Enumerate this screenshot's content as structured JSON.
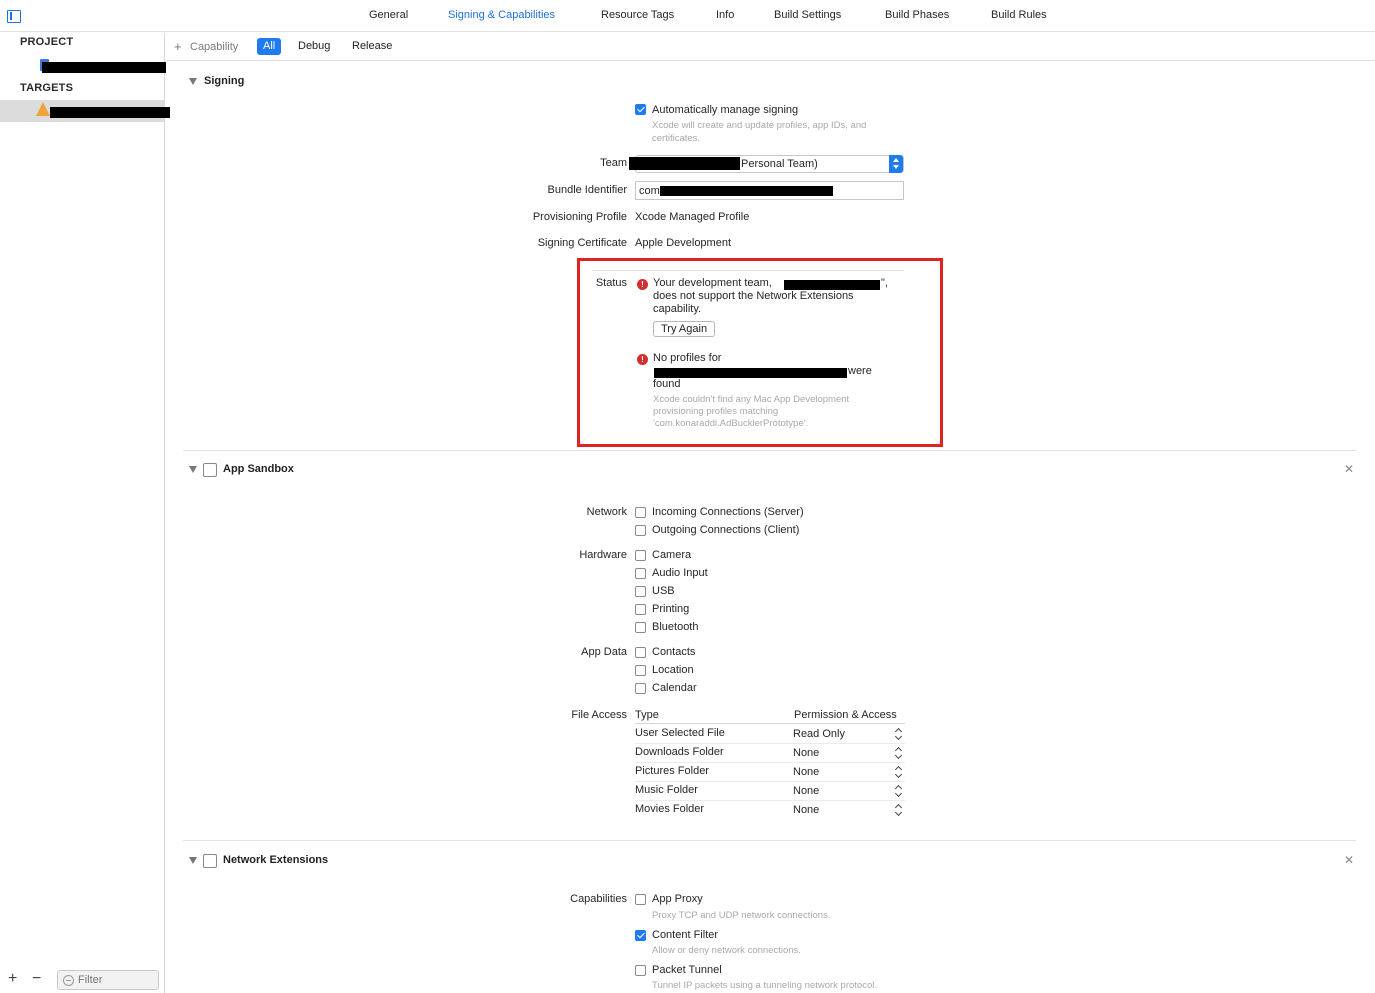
{
  "tabs": [
    "General",
    "Signing & Capabilities",
    "Resource Tags",
    "Info",
    "Build Settings",
    "Build Phases",
    "Build Rules"
  ],
  "active_tab": "Signing & Capabilities",
  "sidebar": {
    "project_header": "PROJECT",
    "targets_header": "TARGETS",
    "filter_placeholder": "Filter"
  },
  "toolbar": {
    "capability_label": "Capability",
    "segments": [
      "All",
      "Debug",
      "Release"
    ],
    "active_segment": "All"
  },
  "signing": {
    "title": "Signing",
    "auto_manage_label": "Automatically manage signing",
    "auto_manage_checked": true,
    "auto_manage_hint_1": "Xcode will create and update profiles, app IDs, and",
    "auto_manage_hint_2": "certificates.",
    "team_label": "Team",
    "team_value": "Personal Team)",
    "bundle_label": "Bundle Identifier",
    "bundle_value": "com",
    "profile_label": "Provisioning Profile",
    "profile_value": "Xcode Managed Profile",
    "cert_label": "Signing Certificate",
    "cert_value": "Apple Development",
    "status_label": "Status",
    "error1_line1": "Your development team,",
    "error1_line1_end": "\",",
    "error1_line2": "does not support the Network Extensions",
    "error1_line3": "capability.",
    "try_again_label": "Try Again",
    "error2_line1": "No profiles for",
    "error2_line2_end": "were",
    "error2_line3": "found",
    "error2_detail_1": "Xcode couldn't find any Mac App Development",
    "error2_detail_2": "provisioning profiles matching",
    "error2_detail_3": "'com.konaraddi.AdBucklerPrototype'."
  },
  "sandbox": {
    "title": "App Sandbox",
    "network_label": "Network",
    "network_items": [
      {
        "label": "Incoming Connections (Server)",
        "checked": false
      },
      {
        "label": "Outgoing Connections (Client)",
        "checked": false
      }
    ],
    "hardware_label": "Hardware",
    "hardware_items": [
      {
        "label": "Camera",
        "checked": false
      },
      {
        "label": "Audio Input",
        "checked": false
      },
      {
        "label": "USB",
        "checked": false
      },
      {
        "label": "Printing",
        "checked": false
      },
      {
        "label": "Bluetooth",
        "checked": false
      }
    ],
    "appdata_label": "App Data",
    "appdata_items": [
      {
        "label": "Contacts",
        "checked": false
      },
      {
        "label": "Location",
        "checked": false
      },
      {
        "label": "Calendar",
        "checked": false
      }
    ],
    "file_access_label": "File Access",
    "file_access_type_header": "Type",
    "file_access_perm_header": "Permission & Access",
    "file_access_rows": [
      {
        "type": "User Selected File",
        "permission": "Read Only"
      },
      {
        "type": "Downloads Folder",
        "permission": "None"
      },
      {
        "type": "Pictures Folder",
        "permission": "None"
      },
      {
        "type": "Music Folder",
        "permission": "None"
      },
      {
        "type": "Movies Folder",
        "permission": "None"
      }
    ]
  },
  "netext": {
    "title": "Network Extensions",
    "capabilities_label": "Capabilities",
    "items": [
      {
        "label": "App Proxy",
        "checked": false,
        "hint": "Proxy TCP and UDP network connections."
      },
      {
        "label": "Content Filter",
        "checked": true,
        "hint": "Allow or deny network connections."
      },
      {
        "label": "Packet Tunnel",
        "checked": false,
        "hint": "Tunnel IP packets using a tunneling network protocol."
      }
    ]
  },
  "colors": {
    "accent": "#1f7cf0",
    "error": "#d12f2f",
    "highlight_box": "#e02424"
  }
}
